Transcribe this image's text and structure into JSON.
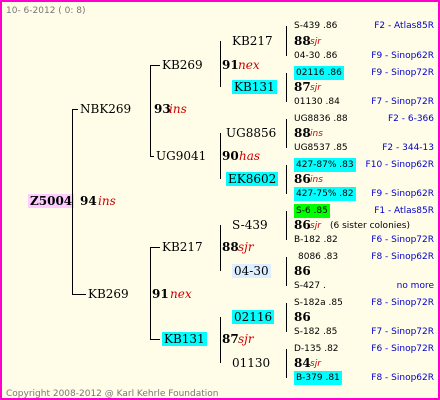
{
  "header": {
    "date": "10-  6-2012 ( 0: 8)"
  },
  "footer": {
    "copyright": "Copyright 2008-2012 @ Karl Kehrle Foundation"
  },
  "root": {
    "id": "Z5004",
    "year": "94",
    "tag": "ins"
  },
  "gen1": [
    {
      "id": "NBK269",
      "year": "93",
      "tag": "ins"
    },
    {
      "id": "KB269",
      "year": "91",
      "tag": "nex"
    }
  ],
  "gen2": [
    {
      "id": "KB269",
      "year": "91",
      "tag": "nex"
    },
    {
      "id": "UG9041",
      "year": "90",
      "tag": "has"
    },
    {
      "id": "KB217",
      "year": "88",
      "tag": "sjr"
    },
    {
      "id": "KB131",
      "year": "87",
      "tag": "sjr"
    }
  ],
  "gen3": [
    {
      "id": "KB217",
      "year": "88",
      "tag": "sjr"
    },
    {
      "id": "KB131",
      "year": "87",
      "tag": "sjr"
    },
    {
      "id": "UG8856",
      "year": "88",
      "tag": "ins"
    },
    {
      "id": "EK8602",
      "year": "86",
      "tag": "ins"
    },
    {
      "id": "S-439",
      "year": "86",
      "tag": "sjr"
    },
    {
      "id": "04-30",
      "year": "86",
      "tag": ""
    },
    {
      "id": "02116",
      "year": "86",
      "tag": ""
    },
    {
      "id": "01130",
      "year": "84",
      "tag": "sjr"
    }
  ],
  "gen4": [
    {
      "label": "S-439 .86",
      "origin": "F2 - Atlas85R"
    },
    {
      "label": "88",
      "tag": "sjr"
    },
    {
      "label": "04-30 .86",
      "origin": "F9 - Sinop62R"
    },
    {
      "label": "02116 .86",
      "origin": "F9 - Sinop72R"
    },
    {
      "label": "87",
      "tag": "sjr"
    },
    {
      "label": "01130 .84",
      "origin": "F7 - Sinop72R"
    },
    {
      "label": "UG8836 .88",
      "origin": "F2 - 6-366"
    },
    {
      "label": "88",
      "tag": "ins"
    },
    {
      "label": "UG8537 .85",
      "origin": "F2 - 344-13"
    },
    {
      "label": "427-87% .83",
      "origin": "F10 - Sinop62R"
    },
    {
      "label": "86",
      "tag": "ins"
    },
    {
      "label": "427-75% .82",
      "origin": "F9 - Sinop62R"
    },
    {
      "label": "S-6 .85",
      "origin": "F1 - Atlas85R"
    },
    {
      "label": "86",
      "tag": "sjr",
      "note": "(6 sister colonies)"
    },
    {
      "label": "B-182 .82",
      "origin": "F6 - Sinop72R"
    },
    {
      "label": "8086 .83",
      "origin": "F8 - Sinop62R"
    },
    {
      "label": "86",
      "tag": ""
    },
    {
      "label": "S-427 .",
      "origin": "no more"
    },
    {
      "label": "S-182a .85",
      "origin": "F8 - Sinop72R"
    },
    {
      "label": "86",
      "tag": ""
    },
    {
      "label": "S-182 .85",
      "origin": "F7 - Sinop72R"
    },
    {
      "label": "D-135 .82",
      "origin": "F6 - Sinop72R"
    },
    {
      "label": "84",
      "tag": "sjr"
    },
    {
      "label": "B-379 .81",
      "origin": "F8 - Sinop62R"
    }
  ]
}
